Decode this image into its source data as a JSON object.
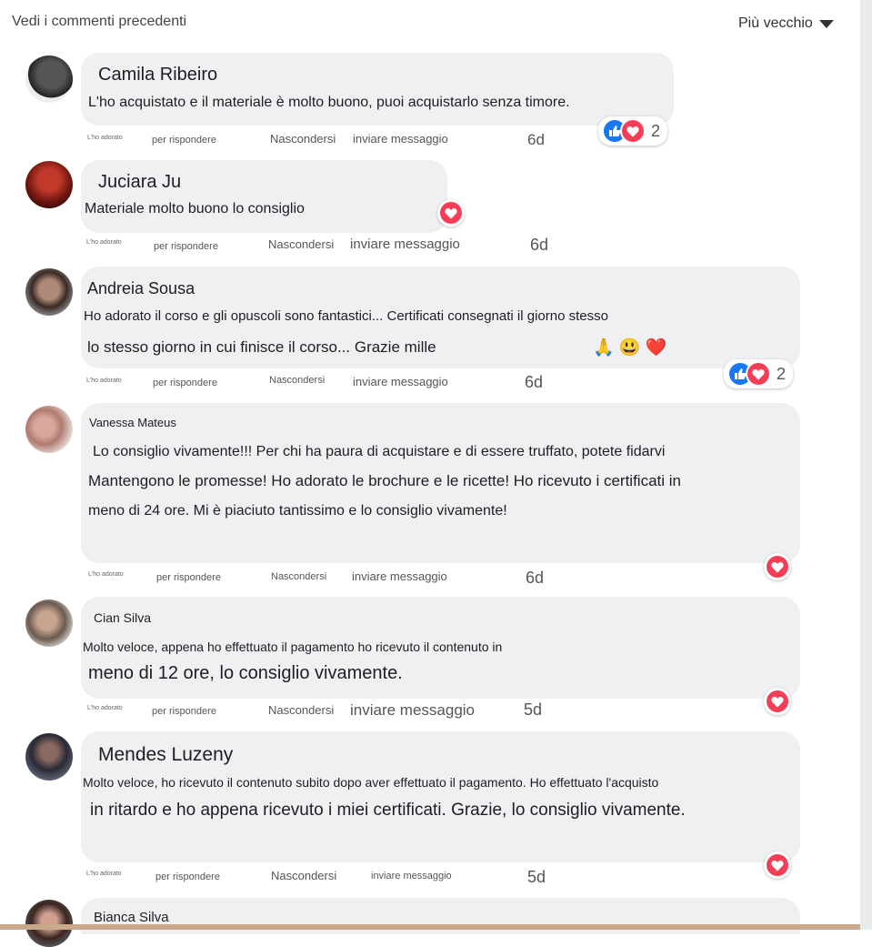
{
  "header": {
    "previous_comments": "Vedi i commenti precedenti",
    "sort_label": "Più vecchio"
  },
  "actions": {
    "liked": "L'ho adorato",
    "reply": "per rispondere",
    "hide": "Nascondersi",
    "message": "inviare messaggio"
  },
  "colors": {
    "like_blue": "#1877f2",
    "love_red": "#f33e58",
    "bubble": "#eef0f2"
  },
  "comments": [
    {
      "author": "Camila Ribeiro",
      "lines": [
        "L'ho acquistato e il materiale è molto buono, puoi acquistarlo senza timore."
      ],
      "time": "6d",
      "reactions": {
        "types": [
          "like",
          "love"
        ],
        "count": "2"
      }
    },
    {
      "author": "Juciara Ju",
      "lines": [
        "Materiale molto buono lo consiglio"
      ],
      "time": "6d",
      "reactions": {
        "types": [
          "love"
        ]
      }
    },
    {
      "author": "Andreia Sousa",
      "lines": [
        "Ho adorato il corso e gli opuscoli sono fantastici... Certificati consegnati il giorno stesso",
        "lo stesso giorno in cui finisce il corso... Grazie mille"
      ],
      "emoji": "🙏 😃 ❤️",
      "time": "6d",
      "reactions": {
        "types": [
          "like",
          "love"
        ],
        "count": "2"
      }
    },
    {
      "author": "Vanessa Mateus",
      "lines": [
        "Lo consiglio vivamente!!! Per chi ha paura di acquistare e di essere truffato, potete fidarvi",
        "Mantengono le promesse! Ho adorato le brochure e le ricette! Ho ricevuto i certificati in",
        "meno di 24 ore. Mi è piaciuto tantissimo e lo consiglio vivamente!"
      ],
      "time": "6d",
      "reactions": {
        "types": [
          "love"
        ]
      }
    },
    {
      "author": "Cian Silva",
      "lines": [
        "Molto veloce, appena ho effettuato il pagamento ho ricevuto il contenuto in",
        "meno di 12 ore, lo consiglio vivamente."
      ],
      "time": "5d",
      "reactions": {
        "types": [
          "love"
        ]
      }
    },
    {
      "author": "Mendes Luzeny",
      "lines": [
        "Molto veloce, ho ricevuto il contenuto subito dopo aver effettuato il pagamento. Ho effettuato l'acquisto",
        "in ritardo e ho appena ricevuto i miei certificati. Grazie, lo consiglio vivamente."
      ],
      "time": "5d",
      "reactions": {
        "types": [
          "love"
        ]
      }
    },
    {
      "author": "Bianca Silva",
      "lines": []
    }
  ]
}
